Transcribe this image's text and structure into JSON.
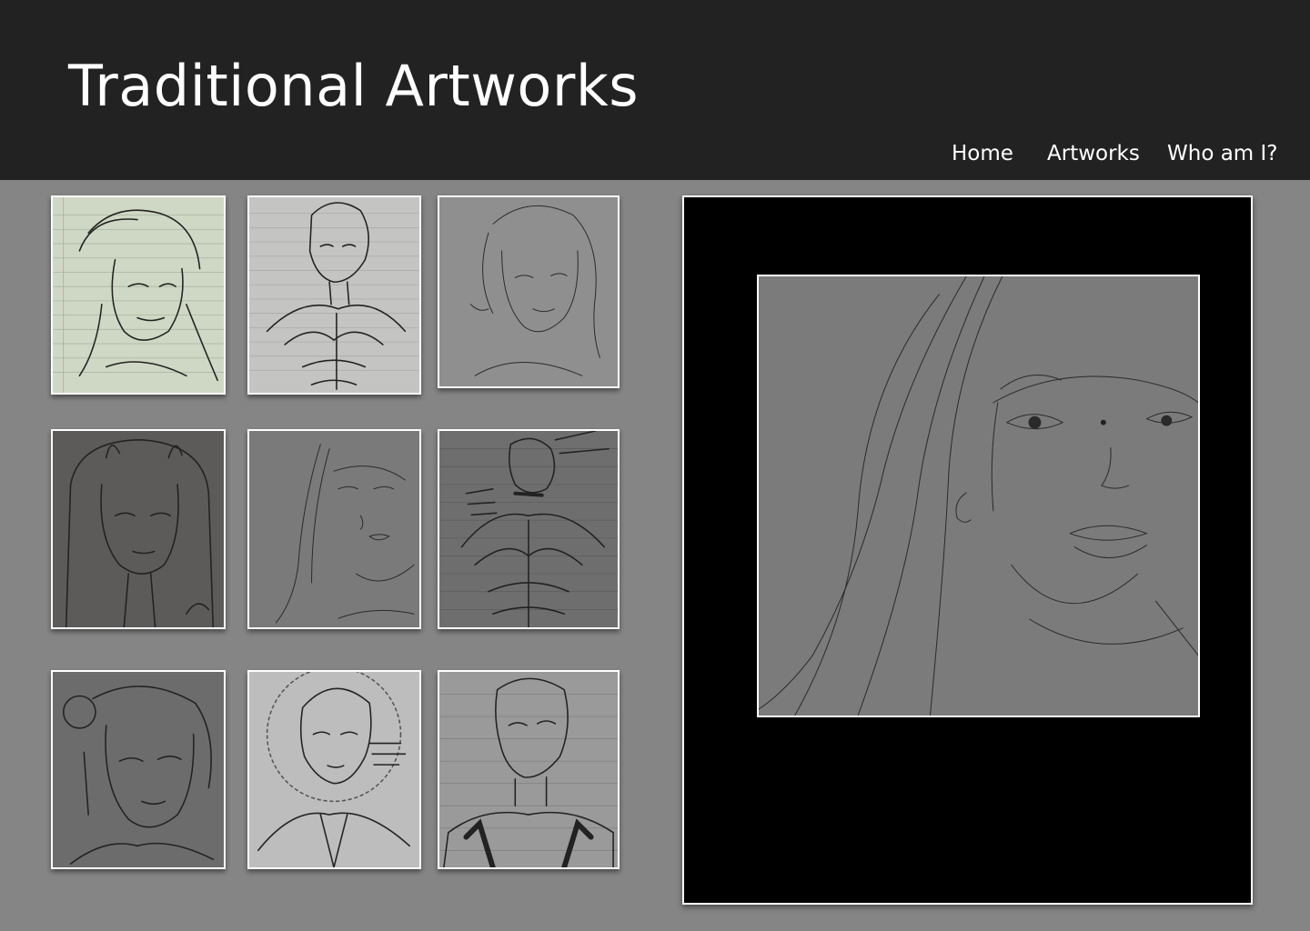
{
  "header": {
    "title": "Traditional Artworks",
    "nav": [
      "Home",
      "Artworks",
      "Who am I?"
    ]
  },
  "colors": {
    "header_bg": "#222222",
    "page_bg": "#858585",
    "viewer_bg": "#000000",
    "frame": "#ffffff"
  },
  "gallery": {
    "thumbnails": [
      {
        "subject": "pencil-portrait-sketch",
        "paper": "#cfd8c4"
      },
      {
        "subject": "pencil-muscular-figure-sketch",
        "paper": "#c4c4c2"
      },
      {
        "subject": "pencil-woman-portrait-sketch",
        "paper": "#8f8f8f"
      },
      {
        "subject": "pencil-hooded-portrait-sketch",
        "paper": "#5d5b5a"
      },
      {
        "subject": "pencil-woman-portrait-sketch",
        "paper": "#7a7a7a"
      },
      {
        "subject": "ink-muscular-figure-sketch",
        "paper": "#6e6e6e"
      },
      {
        "subject": "pencil-portrait-sketch",
        "paper": "#6c6c6c"
      },
      {
        "subject": "pencil-portrait-sketch",
        "paper": "#bdbdbd"
      },
      {
        "subject": "ink-figure-sketch",
        "paper": "#9a9a9a"
      }
    ]
  },
  "viewer": {
    "selected_index": 4,
    "subject": "pencil-woman-portrait-sketch",
    "paper": "#7b7b7b"
  }
}
